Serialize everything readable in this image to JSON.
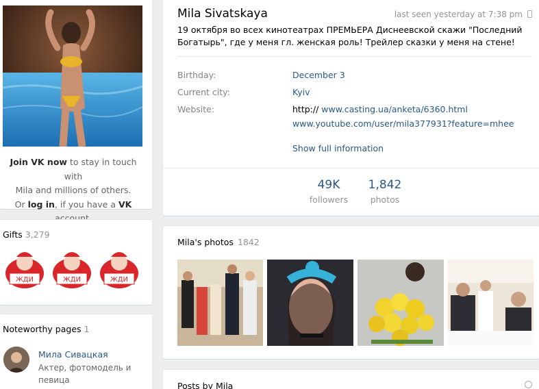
{
  "sidebar": {
    "join_prefix": "Join VK now",
    "join_rest": " to stay in touch with",
    "join_line2": "Mila and millions of others.",
    "join_or": "Or ",
    "join_login": "log in",
    "join_mid": ", if you have a ",
    "join_vk": "VK",
    "join_end": " account.",
    "gifts": {
      "title": "Gifts",
      "count": "3,279"
    },
    "noteworthy": {
      "title": "Noteworthy pages",
      "count": "1",
      "page_name": "Мила Сивацкая",
      "page_desc": "Актер, фотомодель и певица"
    }
  },
  "profile": {
    "name": "Mila Sivatskaya",
    "last_seen": "last seen yesterday at 7:38 pm",
    "status": "19 октября во всех кинотеатрах ПРЕМЬЕРА Диснеевской скажи \"Последний Богатырь\", где у меня гл. женская роль! Трейлер сказки у меня на стене!",
    "birthday_label": "Birthday:",
    "birthday": "December 3",
    "city_label": "Current city:",
    "city": "Kyiv",
    "website_label": "Website:",
    "website_prefix": "http://",
    "website1": "www.casting.ua/anketa/6360.html",
    "website2": "www.youtube.com/user/mila377931?feature=mhee",
    "show_full": "Show full information",
    "followers_count": "49K",
    "followers_label": "followers",
    "photos_count": "1,842",
    "photos_label": "photos"
  },
  "photos_section": {
    "title": "Mila's photos",
    "count": "1842"
  },
  "posts_section": {
    "title": "Posts by Mila"
  },
  "colors": {
    "link": "#2a5885",
    "muted": "#939393",
    "bg": "#edeef0"
  }
}
